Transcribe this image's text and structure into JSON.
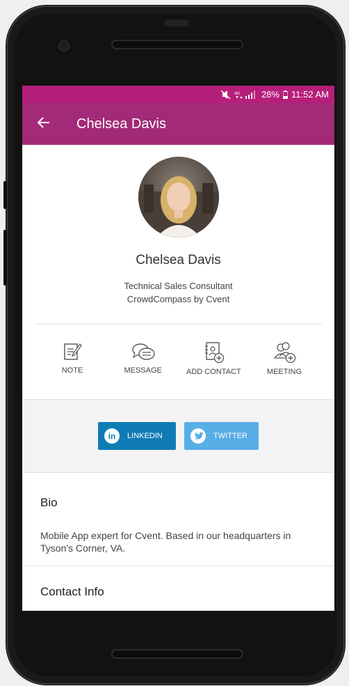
{
  "status_bar": {
    "battery": "28%",
    "time": "11:52 AM",
    "icons": [
      "mute-icon",
      "signal-icon",
      "battery-icon"
    ]
  },
  "app_bar": {
    "title": "Chelsea Davis",
    "back_icon": "arrow-left-icon"
  },
  "profile": {
    "name": "Chelsea Davis",
    "job_title": "Technical Sales Consultant",
    "company": "CrowdCompass by Cvent"
  },
  "actions": [
    {
      "label": "NOTE",
      "icon": "note-icon"
    },
    {
      "label": "MESSAGE",
      "icon": "message-icon"
    },
    {
      "label": "ADD CONTACT",
      "icon": "add-contact-icon"
    },
    {
      "label": "MEETING",
      "icon": "meeting-icon"
    }
  ],
  "social": {
    "linkedin": "LINKEDIN",
    "twitter": "TWITTER"
  },
  "bio": {
    "title": "Bio",
    "text": "Mobile App expert for Cvent. Based in our headquarters in Tyson's Corner, VA."
  },
  "contact": {
    "title": "Contact Info"
  },
  "colors": {
    "status_bar": "#b51f7a",
    "app_bar": "#a32a78",
    "linkedin": "#0f7bb5",
    "twitter": "#58aee6"
  }
}
